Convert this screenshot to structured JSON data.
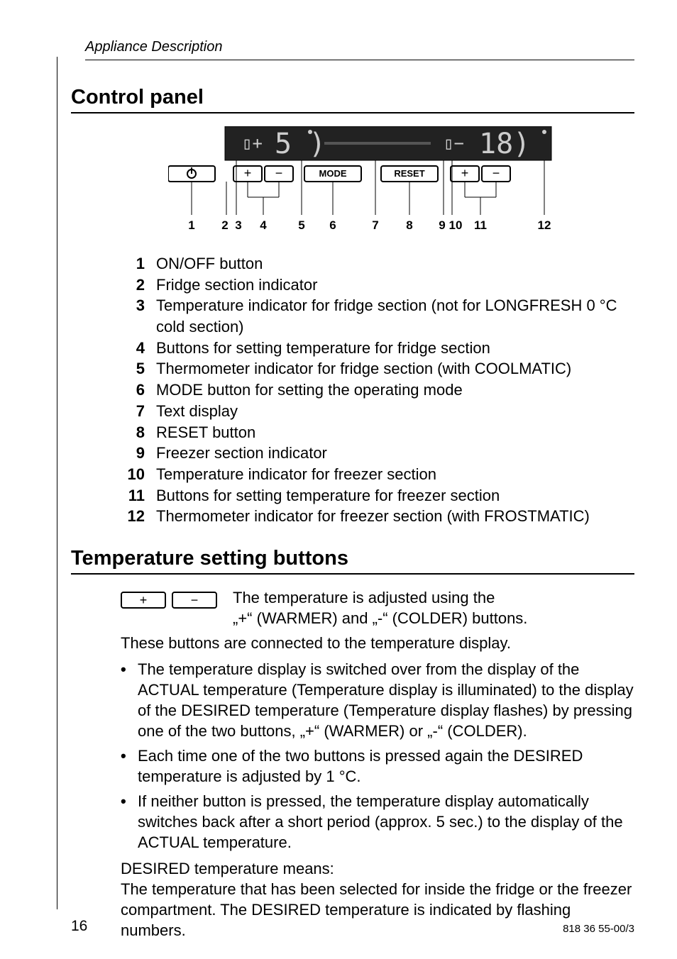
{
  "header": {
    "breadcrumb": "Appliance Description"
  },
  "sections": {
    "control_panel": {
      "title": "Control panel"
    },
    "temp_buttons": {
      "title": "Temperature setting buttons"
    }
  },
  "diagram": {
    "buttons": {
      "mode": "MODE",
      "reset": "RESET"
    },
    "callouts": [
      "1",
      "2",
      "3",
      "4",
      "5",
      "6",
      "7",
      "8",
      "9",
      "10",
      "11",
      "12"
    ]
  },
  "legend": [
    {
      "n": "1",
      "t": "ON/OFF button"
    },
    {
      "n": "2",
      "t": "Fridge section indicator"
    },
    {
      "n": "3",
      "t": "Temperature indicator for fridge section (not for LONGFRESH 0 °C cold section)"
    },
    {
      "n": "4",
      "t": "Buttons for setting temperature for fridge section"
    },
    {
      "n": "5",
      "t": "Thermometer indicator for fridge section (with COOLMATIC)"
    },
    {
      "n": "6",
      "t": "MODE button for setting the operating mode"
    },
    {
      "n": "7",
      "t": "Text display"
    },
    {
      "n": "8",
      "t": "RESET button"
    },
    {
      "n": "9",
      "t": "Freezer section indicator"
    },
    {
      "n": "10",
      "t": "Temperature indicator for freezer section"
    },
    {
      "n": "11",
      "t": "Buttons for setting temperature for freezer section"
    },
    {
      "n": "12",
      "t": "Thermometer indicator for freezer section (with FROSTMATIC)"
    }
  ],
  "temp_intro_l1": "The temperature is adjusted using the",
  "temp_intro_l2": "„+“ (WARMER) and „-“ (COLDER) buttons.",
  "temp_p1": "These buttons are connected to the temperature display.",
  "bullets": [
    "The temperature display is switched over from the display of the ACTUAL temperature (Temperature display is illuminated) to the display of the DESIRED temperature (Temperature display flashes) by pressing one of the two buttons, „+“ (WARMER) or „-“ (COLDER).",
    "Each time one of the two buttons is pressed again the DESIRED temperature is adjusted by 1 °C.",
    "If neither button is pressed, the temperature display automatically switches back after a short period (approx. 5 sec.) to the display of the ACTUAL temperature."
  ],
  "desired_h": "DESIRED temperature means:",
  "desired_p": "The temperature that has been selected for inside the fridge or the freezer compartment. The DESIRED temperature is indicated by flashing numbers.",
  "footer": {
    "page": "16",
    "doc": "818 36 55-00/3"
  }
}
